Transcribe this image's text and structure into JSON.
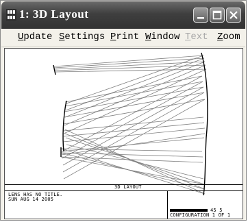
{
  "window": {
    "title": "1: 3D Layout"
  },
  "menu": {
    "items": [
      {
        "label": "Update",
        "mnemonic": "U",
        "rest": "pdate",
        "enabled": true
      },
      {
        "label": "Settings",
        "mnemonic": "S",
        "rest": "ettings",
        "enabled": true
      },
      {
        "label": "Print",
        "mnemonic": "P",
        "rest": "rint",
        "enabled": true
      },
      {
        "label": "Window",
        "mnemonic": "W",
        "rest": "indow",
        "enabled": true
      },
      {
        "label": "Text",
        "mnemonic": "T",
        "rest": "ext",
        "enabled": false
      },
      {
        "label": "Zoom",
        "mnemonic": "Z",
        "rest": "oom",
        "enabled": true
      }
    ]
  },
  "plot": {
    "heading": "3D LAYOUT",
    "lens_title_line": "LENS HAS NO TITLE.",
    "date_line": "SUN AUG 14 2005",
    "scale_line": "[scale bar]  45 5  0 0",
    "configuration_line": "CONFIGURATION 1 OF 1"
  },
  "icons": {
    "app": "zemax-app-icon",
    "minimize": "minimize-icon",
    "maximize": "maximize-icon",
    "close": "close-icon"
  }
}
